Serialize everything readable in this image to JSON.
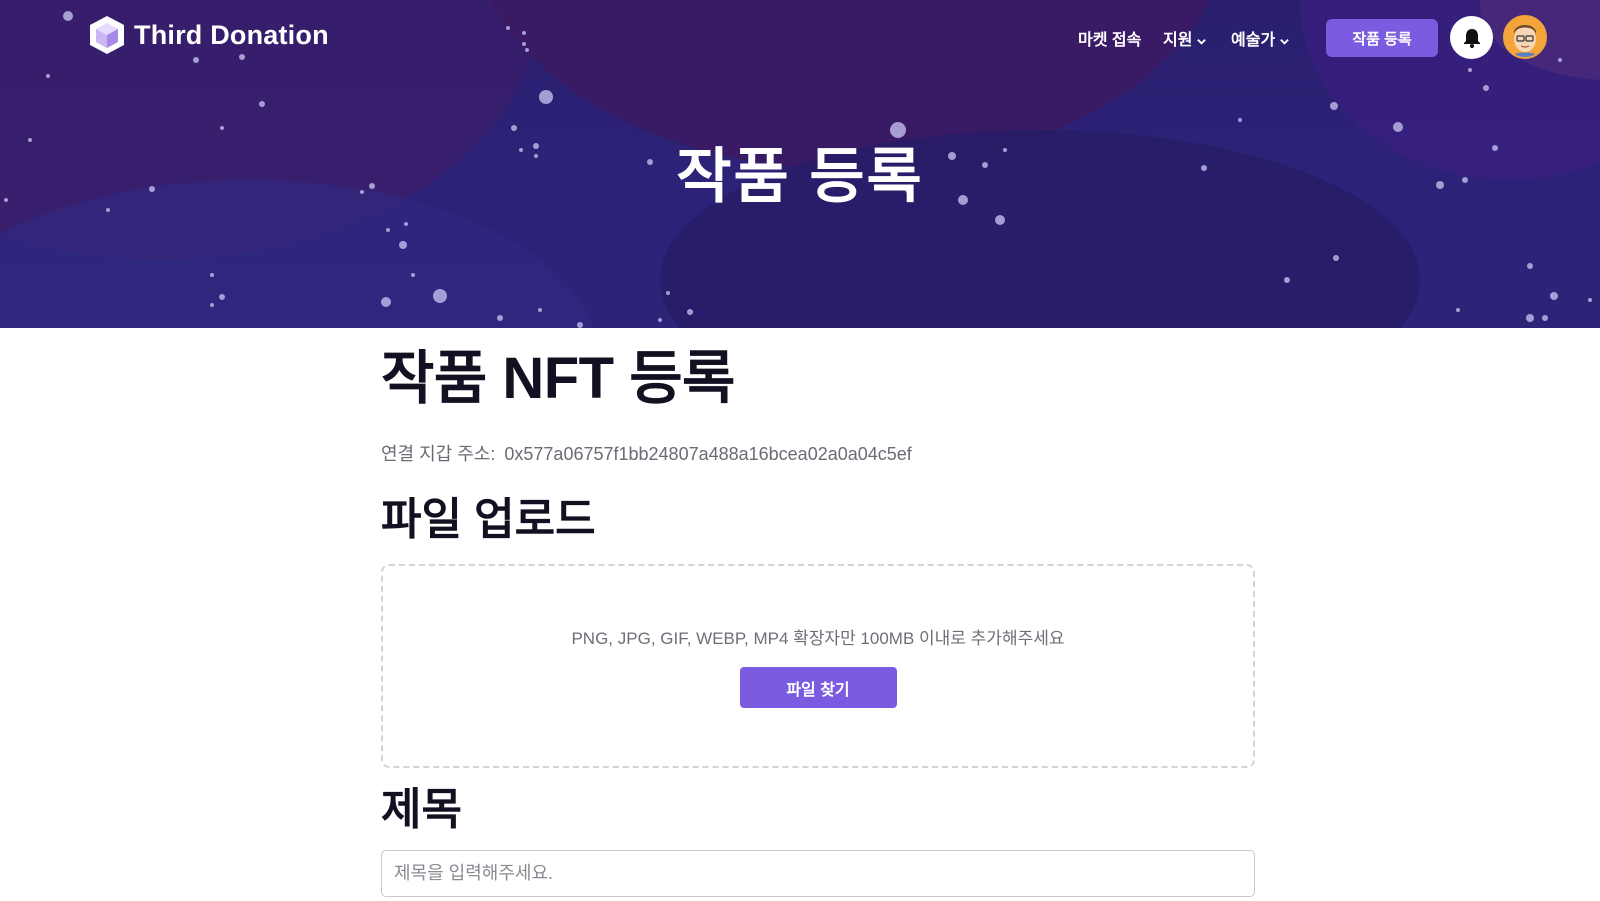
{
  "brand": {
    "name": "Third Donation"
  },
  "nav": {
    "items": [
      {
        "label": "마켓 접속",
        "has_dropdown": false
      },
      {
        "label": "지원",
        "has_dropdown": true
      },
      {
        "label": "예술가",
        "has_dropdown": true
      }
    ],
    "register_button": "작품 등록",
    "icons": {
      "notifications": "bell-icon",
      "profile": "avatar"
    }
  },
  "hero": {
    "title": "작품 등록"
  },
  "main": {
    "page_title": "작품 NFT 등록",
    "wallet_label": "연결 지갑 주소:",
    "wallet_address": "0x577a06757f1bb24807a488a16bcea02a0a04c5ef",
    "upload": {
      "section_title": "파일 업로드",
      "hint": "PNG, JPG, GIF, WEBP, MP4 확장자만 100MB 이내로 추가해주세요",
      "button_label": "파일 찾기"
    },
    "title_field": {
      "section_title": "제목",
      "placeholder": "제목을 입력해주세요.",
      "value": ""
    }
  },
  "colors": {
    "accent": "#7b5ce0",
    "hero_bg": "#2c2277",
    "text_dark": "#111122"
  }
}
